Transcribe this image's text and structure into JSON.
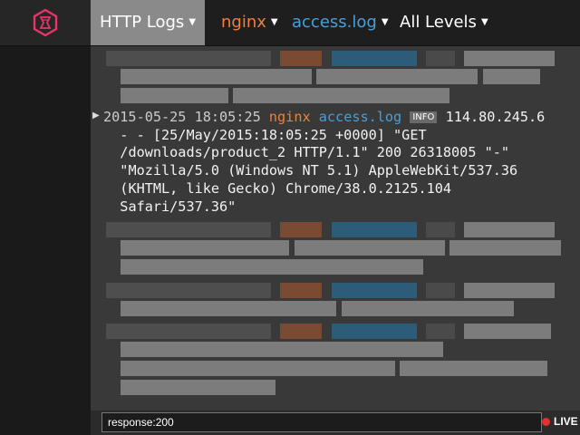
{
  "nav": {
    "app_tab": "HTTP Logs",
    "host_filter": "nginx",
    "file_filter": "access.log",
    "level_filter": "All Levels"
  },
  "log_entry": {
    "timestamp": "2015-05-25 18:05:25",
    "host": "nginx",
    "file": "access.log",
    "level": "INFO",
    "message_first": "114.80.245.6",
    "message_rest": [
      "- - [25/May/2015:18:05:25 +0000] \"GET",
      "/downloads/product_2 HTTP/1.1\" 200 26318005 \"-\"",
      "\"Mozilla/5.0 (Windows NT 5.1) AppleWebKit/537.36",
      "(KHTML, like Gecko) Chrome/38.0.2125.104",
      "Safari/537.36\""
    ]
  },
  "footer": {
    "search_value": "response:200",
    "live_label": "LIVE"
  },
  "colors": {
    "host": "#f0803c",
    "file": "#4a9fd6",
    "live": "#e03030",
    "logo": "#e8336b"
  },
  "icons": {
    "logo": "hexagon-logo-icon",
    "expand": "triangle-right-icon",
    "live": "red-dot-icon"
  }
}
